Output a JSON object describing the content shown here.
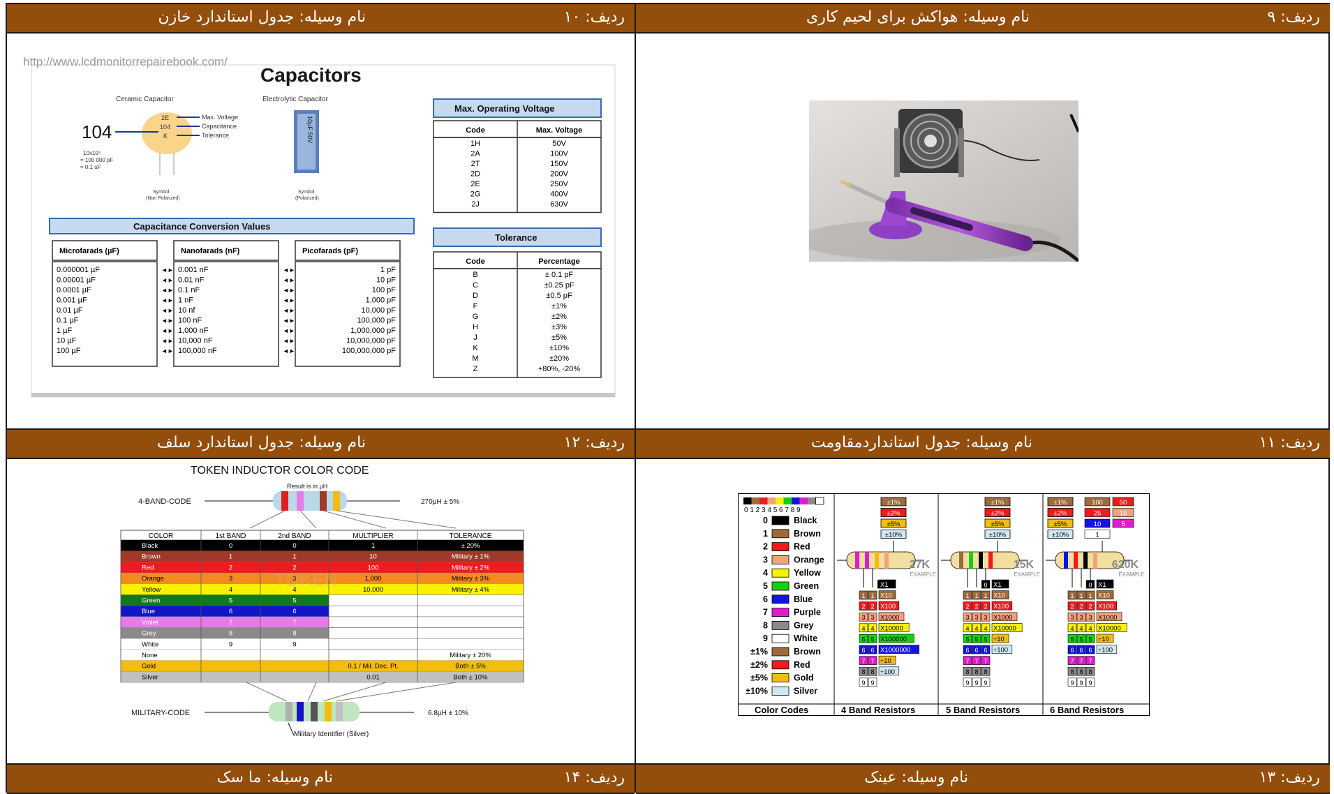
{
  "headers": {
    "h9": {
      "row": "ردیف: ۹",
      "name": "نام وسیله: هواکش برای لحیم کاری"
    },
    "h10": {
      "row": "ردیف: ۱۰",
      "name": "نام وسیله: جدول استاندارد خازن"
    },
    "h11": {
      "row": "ردیف: ۱۱",
      "name": "نام وسیله: جدول استانداردمقاومت"
    },
    "h12": {
      "row": "ردیف: ۱۲",
      "name": "نام وسیله: جدول استاندارد  سلف"
    },
    "h13": {
      "row": "ردیف: ۱۳",
      "name": "نام وسیله: عینک"
    },
    "h14": {
      "row": "ردیف: ۱۴",
      "name": "نام وسیله: ما سک"
    }
  },
  "capacitor_chart": {
    "url": "http://www.lcdmonitorrepairebook.com/",
    "title": "Capacitors",
    "ceramic_label": "Ceramic Capacitor",
    "electrolytic_label": "Electrolytic Capacitor",
    "ceramic_code": "104",
    "ceramic_codes": [
      "2E",
      "104",
      "K"
    ],
    "arrow_labels": [
      "Max. Voltage",
      "Capacitance",
      "Tolerance"
    ],
    "calc_lines": [
      "10x10⁴",
      "= 100 000 pF",
      "= 0.1 uF"
    ],
    "electrolytic_text": "10µF 50V",
    "symbol_np": [
      "Symbol",
      "(Non Polarized)"
    ],
    "symbol_p": [
      "Symbol",
      "(Polarized)"
    ],
    "conversion_title": "Capacitance Conversion Values",
    "conv_headers": [
      "Microfarads (µF)",
      "Nanofarads (nF)",
      "Picofarads (pF)"
    ],
    "uf": [
      "0.000001 µF",
      "0.00001 µF",
      "0.0001 µF",
      "0.001 µF",
      "0.01 µF",
      "0.1 µF",
      "1 µF",
      "10 µF",
      "100 µF"
    ],
    "nf": [
      "0.001 nF",
      "0.01 nF",
      "0.1 nF",
      "1 nF",
      "10 nf",
      "100 nF",
      "1,000 nF",
      "10,000 nF",
      "100,000 nF"
    ],
    "pf": [
      "1 pF",
      "10 pF",
      "100 pF",
      "1,000 pF",
      "10,000 pF",
      "100,000 pF",
      "1,000,000 pF",
      "10,000,000 pF",
      "100,000,000 pF"
    ],
    "voltage_title": "Max. Operating Voltage",
    "voltage_headers": [
      "Code",
      "Max. Voltage"
    ],
    "voltage_codes": [
      "1H",
      "2A",
      "2T",
      "2D",
      "2E",
      "2G",
      "2J"
    ],
    "voltage_values": [
      "50V",
      "100V",
      "150V",
      "200V",
      "250V",
      "400V",
      "630V"
    ],
    "tolerance_title": "Tolerance",
    "tolerance_headers": [
      "Code",
      "Percentage"
    ],
    "tol_codes": [
      "B",
      "C",
      "D",
      "F",
      "G",
      "H",
      "J",
      "K",
      "M",
      "Z"
    ],
    "tol_values": [
      "± 0.1 pF",
      "±0.25 pF",
      "±0.5 pF",
      "±1%",
      "±2%",
      "±3%",
      "±5%",
      "±10%",
      "±20%",
      "+80%, -20%"
    ]
  },
  "inductor_chart": {
    "title": "TOKEN   INDUCTOR   COLOR   CODE",
    "result": "Result is in µH",
    "band4": "4-BAND-CODE",
    "example4": "270µH ± 5%",
    "headers": [
      "COLOR",
      "1st BAND",
      "2nd BAND",
      "MULTIPLIER",
      "TOLERANCE"
    ],
    "rows": [
      {
        "color": "Black",
        "b1": "0",
        "b2": "0",
        "mult": "1",
        "tol": "± 20%",
        "bg": "#000000",
        "fg": "#ffffff"
      },
      {
        "color": "Brown",
        "b1": "1",
        "b2": "1",
        "mult": "10",
        "tol": "Military ± 1%",
        "bg": "#a0392a",
        "fg": "#ffffff"
      },
      {
        "color": "Red",
        "b1": "2",
        "b2": "2",
        "mult": "100",
        "tol": "Military ± 2%",
        "bg": "#ee1c1c",
        "fg": "#ffffff"
      },
      {
        "color": "Orange",
        "b1": "3",
        "b2": "3",
        "mult": "1,000",
        "tol": "Military ± 3%",
        "bg": "#f58a1f",
        "fg": "#000000"
      },
      {
        "color": "Yellow",
        "b1": "4",
        "b2": "4",
        "mult": "10,000",
        "tol": "Military ± 4%",
        "bg": "#f8f200",
        "fg": "#000000"
      },
      {
        "color": "Green",
        "b1": "5",
        "b2": "5",
        "mult": "",
        "tol": "",
        "bg": "#0f7a1c",
        "fg": "#ffffff"
      },
      {
        "color": "Blue",
        "b1": "6",
        "b2": "6",
        "mult": "",
        "tol": "",
        "bg": "#1414c8",
        "fg": "#ffffff"
      },
      {
        "color": "Violet",
        "b1": "7",
        "b2": "7",
        "mult": "",
        "tol": "",
        "bg": "#e37ce8",
        "fg": "#ffffff"
      },
      {
        "color": "Grey",
        "b1": "8",
        "b2": "8",
        "mult": "",
        "tol": "",
        "bg": "#8a8a8a",
        "fg": "#ffffff"
      },
      {
        "color": "White",
        "b1": "9",
        "b2": "9",
        "mult": "",
        "tol": "",
        "bg": "#ffffff",
        "fg": "#000000"
      },
      {
        "color": "None",
        "b1": "",
        "b2": "",
        "mult": "",
        "tol": "Military ± 20%",
        "bg": "#ffffff",
        "fg": "#000000"
      },
      {
        "color": "Gold",
        "b1": "",
        "b2": "",
        "mult": "0.1 / Mil. Dec. Pt.",
        "tol": "Both ± 5%",
        "bg": "#f2bd10",
        "fg": "#000000"
      },
      {
        "color": "Silver",
        "b1": "",
        "b2": "",
        "mult": "0.01",
        "tol": "Both ± 10%",
        "bg": "#c0c0c0",
        "fg": "#000000"
      }
    ],
    "military": "MILITARY-CODE",
    "example_mil": "6.8µH ± 10%",
    "mil_identifier": "Military Identifier (Silver)",
    "watermark": "TOKEN"
  },
  "resistor_chart": {
    "digits": "0 1 2 3 4 5 6 7 8 9",
    "codes": [
      {
        "num": "0",
        "name": "Black",
        "color": "#000000"
      },
      {
        "num": "1",
        "name": "Brown",
        "color": "#9c6a3c"
      },
      {
        "num": "2",
        "name": "Red",
        "color": "#ee1c1c"
      },
      {
        "num": "3",
        "name": "Orange",
        "color": "#f2a27a"
      },
      {
        "num": "4",
        "name": "Yellow",
        "color": "#f8f200"
      },
      {
        "num": "5",
        "name": "Green",
        "color": "#14d014"
      },
      {
        "num": "6",
        "name": "Blue",
        "color": "#1414e0"
      },
      {
        "num": "7",
        "name": "Purple",
        "color": "#e01cd0"
      },
      {
        "num": "8",
        "name": "Grey",
        "color": "#8a8a8a"
      },
      {
        "num": "9",
        "name": "White",
        "color": "#ffffff"
      },
      {
        "num": "±1%",
        "name": "Brown",
        "color": "#9c6a3c"
      },
      {
        "num": "±2%",
        "name": "Red",
        "color": "#ee1c1c"
      },
      {
        "num": "±5%",
        "name": "Gold",
        "color": "#f2bd10"
      },
      {
        "num": "±10%",
        "name": "Silver",
        "color": "#d0e8f0"
      }
    ],
    "tol_tags": [
      "±1%",
      "±2%",
      "±5%",
      "±10%"
    ],
    "ex4": "27K",
    "ex5": "15K",
    "ex6": "620K",
    "example_word": "EXAMPLE",
    "multipliers4": [
      "X1",
      "X10",
      "X100",
      "X1000",
      "X10000",
      "X100000",
      "X1000000",
      "÷10",
      "÷100"
    ],
    "multipliers5": [
      "X1",
      "X10",
      "X100",
      "X1000",
      "X10000",
      "÷10",
      "÷100"
    ],
    "multipliers6": [
      "X1",
      "X10",
      "X100",
      "X1000",
      "X10000",
      "÷10",
      "÷100"
    ],
    "tempco": [
      "100",
      "50",
      "25",
      "15",
      "10",
      "5",
      "1"
    ],
    "footers": [
      "Color Codes",
      "4 Band Resistors",
      "5 Band Resistors",
      "6 Band Resistors"
    ]
  }
}
